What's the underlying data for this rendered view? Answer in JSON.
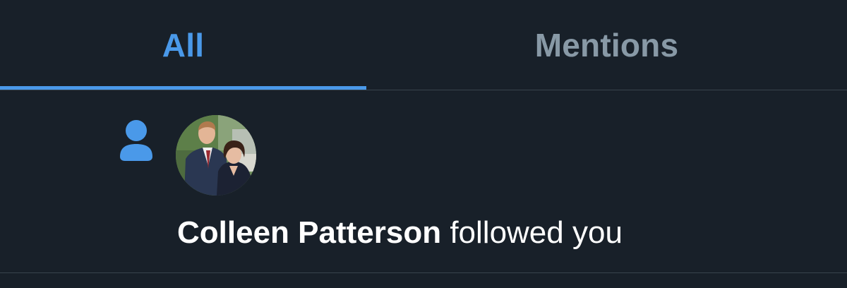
{
  "tabs": {
    "all_label": "All",
    "mentions_label": "Mentions",
    "active": "All"
  },
  "notification": {
    "type": "follow",
    "icon": "person-icon",
    "avatar_icon": "user-avatar-photo",
    "user_name": "Colleen Patterson",
    "action_text": " followed you"
  },
  "colors": {
    "background": "#182029",
    "accent": "#4a99e9",
    "inactive_tab": "#8899a6",
    "divider": "#38444d",
    "text": "#ffffff"
  }
}
